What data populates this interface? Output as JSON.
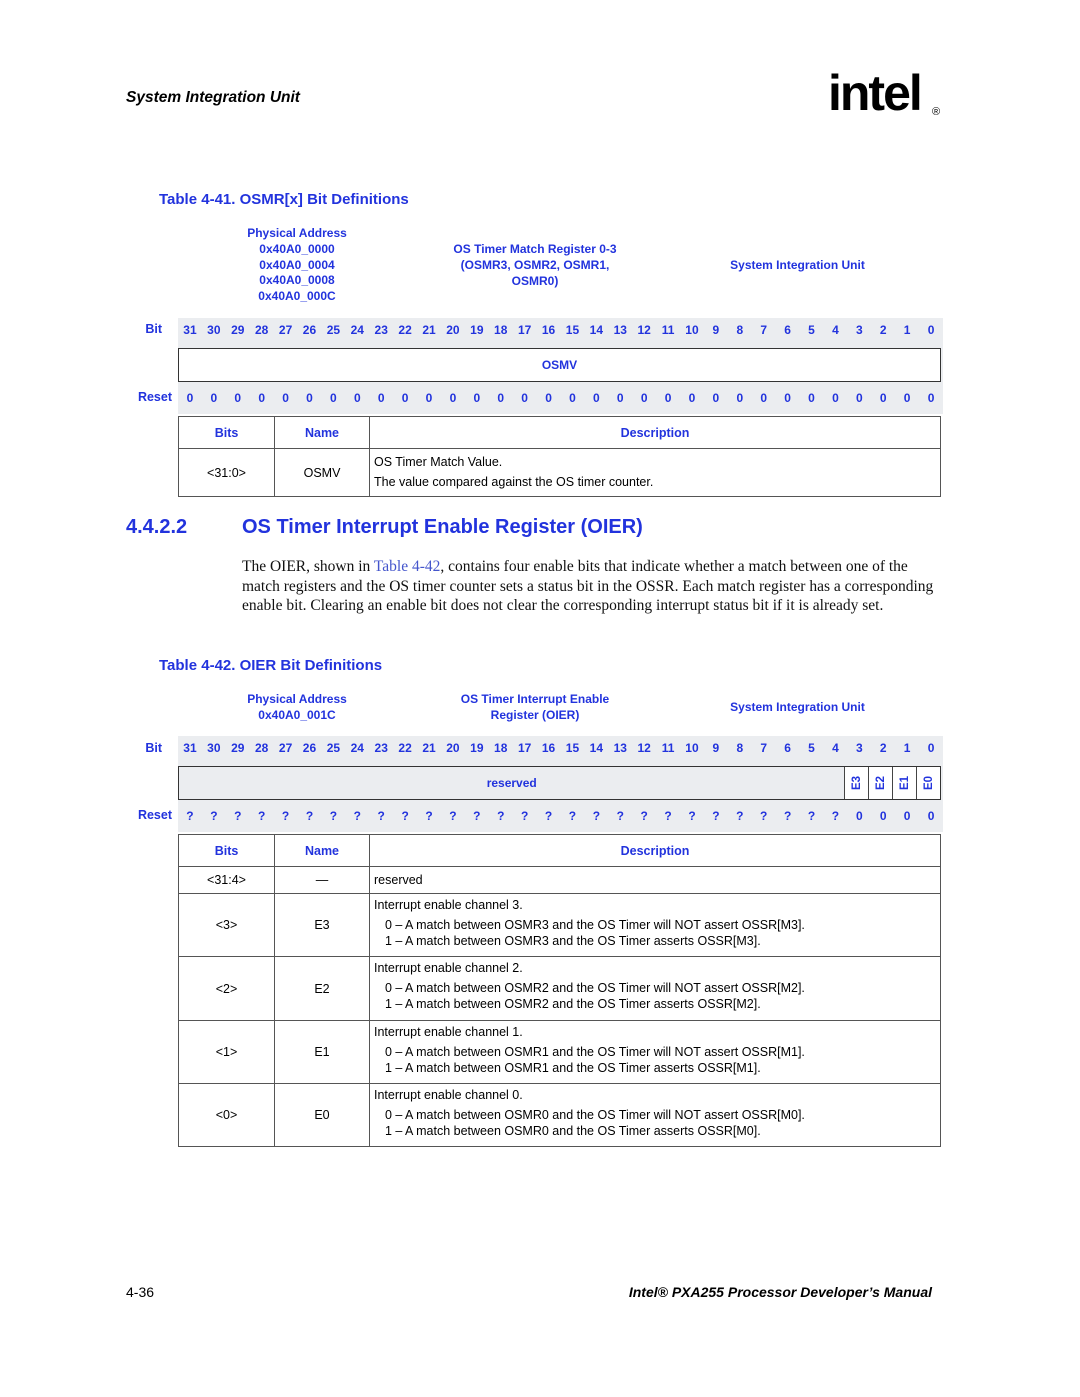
{
  "header": {
    "running_title": "System Integration Unit",
    "logo_text": "intel",
    "logo_mark": "®"
  },
  "table41": {
    "title": "Table 4-41. OSMR[x] Bit Definitions",
    "physical_address_label": "Physical Address",
    "addresses": [
      "0x40A0_0000",
      "0x40A0_0004",
      "0x40A0_0008",
      "0x40A0_000C"
    ],
    "register_name_lines": [
      "OS Timer Match Register 0-3",
      "(OSMR3, OSMR2, OSMR1,",
      "OSMR0)"
    ],
    "unit": "System Integration Unit",
    "bit_label": "Bit",
    "reset_label": "Reset",
    "bits": [
      "31",
      "30",
      "29",
      "28",
      "27",
      "26",
      "25",
      "24",
      "23",
      "22",
      "21",
      "20",
      "19",
      "18",
      "17",
      "16",
      "15",
      "14",
      "13",
      "12",
      "11",
      "10",
      "9",
      "8",
      "7",
      "6",
      "5",
      "4",
      "3",
      "2",
      "1",
      "0"
    ],
    "field_name": "OSMV",
    "reset_values": [
      "0",
      "0",
      "0",
      "0",
      "0",
      "0",
      "0",
      "0",
      "0",
      "0",
      "0",
      "0",
      "0",
      "0",
      "0",
      "0",
      "0",
      "0",
      "0",
      "0",
      "0",
      "0",
      "0",
      "0",
      "0",
      "0",
      "0",
      "0",
      "0",
      "0",
      "0",
      "0"
    ],
    "columns": [
      "Bits",
      "Name",
      "Description"
    ],
    "rows": [
      {
        "bits": "<31:0>",
        "name": "OSMV",
        "desc_lines": [
          "OS Timer Match Value.",
          "The value compared against the OS timer counter."
        ]
      }
    ]
  },
  "section": {
    "number": "4.4.2.2",
    "title": "OS Timer Interrupt Enable Register (OIER)",
    "para_before_link": "The OIER, shown in ",
    "para_link": "Table 4-42",
    "para_after_link": ", contains four enable bits that indicate whether a match between one of the match registers and the OS timer counter sets a status bit in the OSSR. Each match register has a corresponding enable bit. Clearing an enable bit does not clear the corresponding interrupt status bit if it is already set."
  },
  "table42": {
    "title": "Table 4-42. OIER Bit Definitions",
    "physical_address_label": "Physical Address",
    "address": "0x40A0_001C",
    "register_name_lines": [
      "OS Timer Interrupt Enable",
      "Register (OIER)"
    ],
    "unit": "System Integration Unit",
    "bit_label": "Bit",
    "reset_label": "Reset",
    "bits": [
      "31",
      "30",
      "29",
      "28",
      "27",
      "26",
      "25",
      "24",
      "23",
      "22",
      "21",
      "20",
      "19",
      "18",
      "17",
      "16",
      "15",
      "14",
      "13",
      "12",
      "11",
      "10",
      "9",
      "8",
      "7",
      "6",
      "5",
      "4",
      "3",
      "2",
      "1",
      "0"
    ],
    "fields": {
      "reserved": "reserved",
      "bit_fields": [
        "E3",
        "E2",
        "E1",
        "E0"
      ]
    },
    "reset_values": [
      "?",
      "?",
      "?",
      "?",
      "?",
      "?",
      "?",
      "?",
      "?",
      "?",
      "?",
      "?",
      "?",
      "?",
      "?",
      "?",
      "?",
      "?",
      "?",
      "?",
      "?",
      "?",
      "?",
      "?",
      "?",
      "?",
      "?",
      "?",
      "0",
      "0",
      "0",
      "0"
    ],
    "columns": [
      "Bits",
      "Name",
      "Description"
    ],
    "rows": [
      {
        "bits": "<31:4>",
        "name": "—",
        "desc": "reserved"
      },
      {
        "bits": "<3>",
        "name": "E3",
        "desc": "Interrupt enable channel 3.",
        "options": [
          {
            "k": "0 –",
            "t": "A match between OSMR3 and the OS Timer will NOT assert OSSR[M3]."
          },
          {
            "k": "1 –",
            "t": "A match between OSMR3 and the OS Timer asserts OSSR[M3]."
          }
        ]
      },
      {
        "bits": "<2>",
        "name": "E2",
        "desc": "Interrupt enable channel 2.",
        "options": [
          {
            "k": "0 –",
            "t": "A match between OSMR2 and the OS Timer will NOT assert OSSR[M2]."
          },
          {
            "k": "1 –",
            "t": "A match between OSMR2 and the OS Timer asserts OSSR[M2]."
          }
        ]
      },
      {
        "bits": "<1>",
        "name": "E1",
        "desc": "Interrupt enable channel 1.",
        "options": [
          {
            "k": "0 –",
            "t": "A match between OSMR1 and the OS Timer will NOT assert OSSR[M1]."
          },
          {
            "k": "1 –",
            "t": "A match between OSMR1 and the OS Timer asserts OSSR[M1]."
          }
        ]
      },
      {
        "bits": "<0>",
        "name": "E0",
        "desc": "Interrupt enable channel 0.",
        "options": [
          {
            "k": "0 –",
            "t": "A match between OSMR0 and the OS Timer will NOT assert OSSR[M0]."
          },
          {
            "k": "1 –",
            "t": "A match between OSMR0 and the OS Timer asserts OSSR[M0]."
          }
        ]
      }
    ]
  },
  "footer": {
    "page_number": "4-36",
    "manual_title": "Intel® PXA255 Processor Developer’s Manual"
  }
}
